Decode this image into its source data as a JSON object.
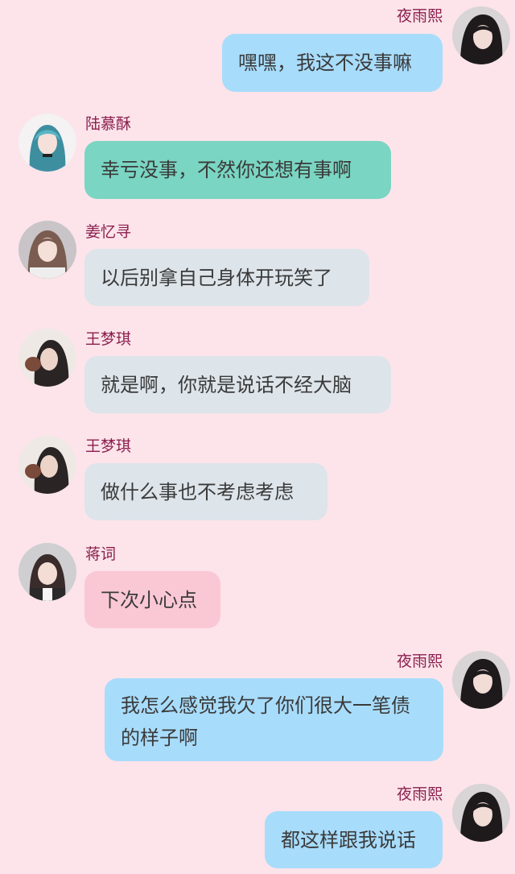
{
  "colors": {
    "background": "#fce4ea",
    "name": "#8a1f4e",
    "bubble_self": "#a8dcfb",
    "bubble_teal": "#7ad5c2",
    "bubble_gray": "#dde4ea",
    "bubble_pink": "#fac8d4"
  },
  "messages": [
    {
      "sender": "夜雨熙",
      "text": "嘿嘿，我这不没事嘛",
      "side": "right",
      "avatar": "avatar-yeyuxi"
    },
    {
      "sender": "陆慕酥",
      "text": "幸亏没事，不然你还想有事啊",
      "side": "left",
      "avatar": "avatar-lumusu"
    },
    {
      "sender": "姜忆寻",
      "text": "以后别拿自己身体开玩笑了",
      "side": "left",
      "avatar": "avatar-jiangyixun"
    },
    {
      "sender": "王梦琪",
      "text": "就是啊，你就是说话不经大脑",
      "side": "left",
      "avatar": "avatar-wangmengqi"
    },
    {
      "sender": "王梦琪",
      "text": "做什么事也不考虑考虑",
      "side": "left",
      "avatar": "avatar-wangmengqi"
    },
    {
      "sender": "蒋词",
      "text": "下次小心点",
      "side": "left",
      "avatar": "avatar-jiangci"
    },
    {
      "sender": "夜雨熙",
      "text": "我怎么感觉我欠了你们很大一笔债的样子啊",
      "side": "right",
      "avatar": "avatar-yeyuxi"
    },
    {
      "sender": "夜雨熙",
      "text": "都这样跟我说话",
      "side": "right",
      "avatar": "avatar-yeyuxi"
    }
  ]
}
